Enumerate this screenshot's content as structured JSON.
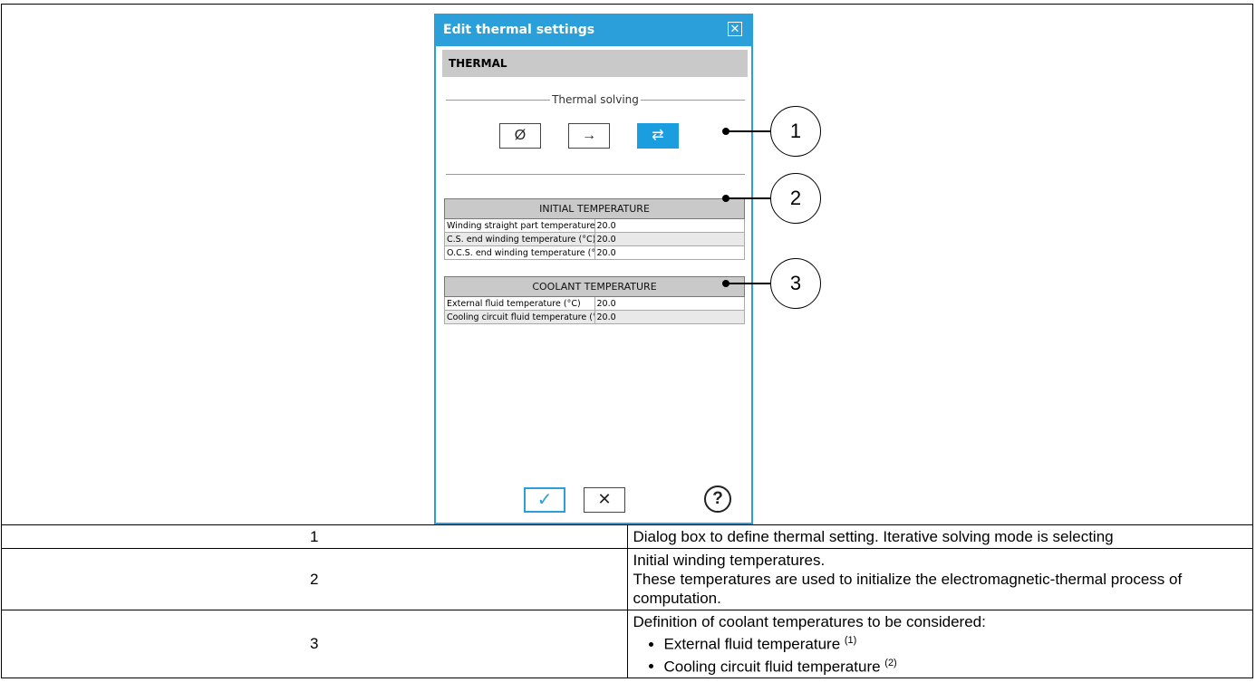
{
  "dialog": {
    "title": "Edit thermal settings",
    "close_icon": "close-icon",
    "section_header": "THERMAL",
    "fieldset_label": "Thermal solving",
    "mode_buttons": [
      {
        "icon": "none-icon",
        "glyph": "Ø",
        "active": false
      },
      {
        "icon": "arrow-right-icon",
        "glyph": "→",
        "active": false
      },
      {
        "icon": "iterative-arrows-icon",
        "glyph": "⇄",
        "active": true
      }
    ],
    "initial_temperature": {
      "header": "INITIAL TEMPERATURE",
      "rows": [
        {
          "label": "Winding straight part temperature (°C)",
          "value": "20.0"
        },
        {
          "label": "C.S. end winding temperature (°C)",
          "value": "20.0"
        },
        {
          "label": "O.C.S. end winding temperature (°C)",
          "value": "20.0"
        }
      ]
    },
    "coolant_temperature": {
      "header": "COOLANT TEMPERATURE",
      "rows": [
        {
          "label": "External fluid temperature (°C)",
          "value": "20.0"
        },
        {
          "label": "Cooling circuit fluid temperature (°C)",
          "value": "20.0"
        }
      ]
    },
    "ok_glyph": "✓",
    "cancel_glyph": "✕",
    "help_glyph": "?"
  },
  "callouts": [
    "1",
    "2",
    "3"
  ],
  "descriptions": [
    {
      "number": "1",
      "lines": [
        "Dialog box to define thermal setting. Iterative solving mode is selecting"
      ]
    },
    {
      "number": "2",
      "lines": [
        "Initial winding temperatures.",
        "These temperatures are used to initialize the electromagnetic-thermal process of computation."
      ]
    },
    {
      "number": "3",
      "intro": "Definition of coolant temperatures to be considered:",
      "bullets": [
        {
          "text": "External fluid temperature ",
          "note": "(1)"
        },
        {
          "text": "Cooling circuit fluid temperature ",
          "note": "(2)"
        }
      ]
    }
  ]
}
